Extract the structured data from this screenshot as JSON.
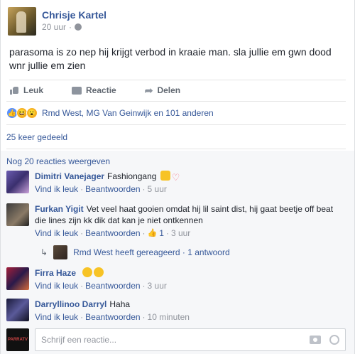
{
  "post": {
    "author": "Chrisje Kartel",
    "time": "20 uur",
    "separator": "·",
    "text": "parasoma is zo nep hij krijgt verbod in kraaie man. sla jullie em gwn dood wnr jullie em zien"
  },
  "actions": {
    "like": "Leuk",
    "comment": "Reactie",
    "share": "Delen"
  },
  "reactions": {
    "summary": "Rmd West, MG Van Geinwijk en 101 anderen",
    "icons": [
      "like",
      "haha",
      "wow"
    ]
  },
  "shares": {
    "label": "25 keer gedeeld"
  },
  "comments": {
    "more_label": "Nog 20 reacties weergeven",
    "items": [
      {
        "author": "Dimitri Vanejager",
        "text": "Fashiongang",
        "like_label": "Vind ik leuk",
        "reply_label": "Beantwoorden",
        "time": "5 uur"
      },
      {
        "author": "Furkan Yigit",
        "text": "Vet veel haat gooien omdat hij lil saint dist, hij gaat beetje off beat die lines zijn kk dik dat kan je niet ontkennen",
        "like_label": "Vind ik leuk",
        "reply_label": "Beantwoorden",
        "likes": "1",
        "time": "3 uur"
      },
      {
        "author": "Firra Haze",
        "text": "",
        "like_label": "Vind ik leuk",
        "reply_label": "Beantwoorden",
        "time": "3 uur"
      },
      {
        "author": "Darryllinoo Darryl",
        "text": "Haha",
        "like_label": "Vind ik leuk",
        "reply_label": "Beantwoorden",
        "time": "10 minuten"
      }
    ],
    "reply_summary": "Rmd West heeft gereageerd · 1 antwoord"
  },
  "composer": {
    "placeholder": "Schrijf een reactie...",
    "avatar_text": "PARRATV"
  },
  "colors": {
    "link": "#365899",
    "meta": "#90949c",
    "text": "#1d2129",
    "like_blue": "#5890ff"
  }
}
